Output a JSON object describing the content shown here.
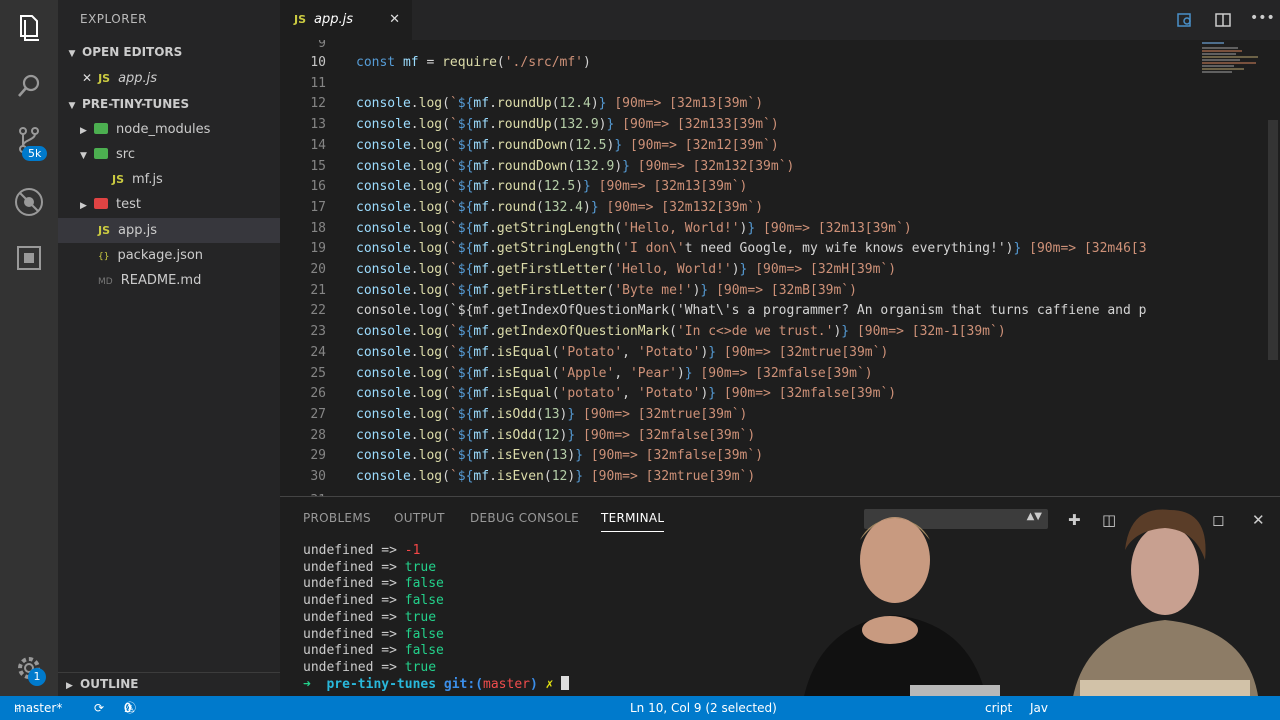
{
  "sidebar": {
    "title": "EXPLORER",
    "open_editors_label": "OPEN EDITORS",
    "open_editor_file": "app.js",
    "project_label": "PRE-TINY-TUNES",
    "tree": [
      {
        "label": "node_modules",
        "kind": "folder-green",
        "expanded": false
      },
      {
        "label": "src",
        "kind": "folder-green",
        "expanded": true
      },
      {
        "label": "mf.js",
        "kind": "js",
        "indent": 2
      },
      {
        "label": "test",
        "kind": "folder-red",
        "expanded": false
      },
      {
        "label": "app.js",
        "kind": "js",
        "selected": true
      },
      {
        "label": "package.json",
        "kind": "json"
      },
      {
        "label": "README.md",
        "kind": "md"
      }
    ],
    "outline_label": "OUTLINE"
  },
  "activity": {
    "scm_badge": "5k",
    "settings_badge": "1"
  },
  "editor": {
    "tab_label": "app.js",
    "tab_icon": "JS",
    "partial_top_line": "9",
    "partial_bottom_line": "31",
    "lines": [
      {
        "n": "10",
        "text": "const mf = require('./src/mf')"
      },
      {
        "n": "11",
        "text": ""
      },
      {
        "n": "12",
        "text": "console.log(`${mf.roundUp(12.4)} [90m=> [32m13[39m`)"
      },
      {
        "n": "13",
        "text": "console.log(`${mf.roundUp(132.9)} [90m=> [32m133[39m`)"
      },
      {
        "n": "14",
        "text": "console.log(`${mf.roundDown(12.5)} [90m=> [32m12[39m`)"
      },
      {
        "n": "15",
        "text": "console.log(`${mf.roundDown(132.9)} [90m=> [32m132[39m`)"
      },
      {
        "n": "16",
        "text": "console.log(`${mf.round(12.5)} [90m=> [32m13[39m`)"
      },
      {
        "n": "17",
        "text": "console.log(`${mf.round(132.4)} [90m=> [32m132[39m`)"
      },
      {
        "n": "18",
        "text": "console.log(`${mf.getStringLength('Hello, World!')} [90m=> [32m13[39m`)"
      },
      {
        "n": "19",
        "text": "console.log(`${mf.getStringLength('I don\\'t need Google, my wife knows everything!')} [90m=> [32m46[3"
      },
      {
        "n": "20",
        "text": "console.log(`${mf.getFirstLetter('Hello, World!')} [90m=> [32mH[39m`)"
      },
      {
        "n": "21",
        "text": "console.log(`${mf.getFirstLetter('Byte me!')} [90m=> [32mB[39m`)"
      },
      {
        "n": "22",
        "text": "console.log(`${mf.getIndexOfQuestionMark('What\\'s a programmer? An organism that turns caffiene and p"
      },
      {
        "n": "23",
        "text": "console.log(`${mf.getIndexOfQuestionMark('In c<>de we trust.')} [90m=> [32m-1[39m`)"
      },
      {
        "n": "24",
        "text": "console.log(`${mf.isEqual('Potato', 'Potato')} [90m=> [32mtrue[39m`)"
      },
      {
        "n": "25",
        "text": "console.log(`${mf.isEqual('Apple', 'Pear')} [90m=> [32mfalse[39m`)"
      },
      {
        "n": "26",
        "text": "console.log(`${mf.isEqual('potato', 'Potato')} [90m=> [32mfalse[39m`)"
      },
      {
        "n": "27",
        "text": "console.log(`${mf.isOdd(13)} [90m=> [32mtrue[39m`)"
      },
      {
        "n": "28",
        "text": "console.log(`${mf.isOdd(12)} [90m=> [32mfalse[39m`)"
      },
      {
        "n": "29",
        "text": "console.log(`${mf.isEven(13)} [90m=> [32mfalse[39m`)"
      },
      {
        "n": "30",
        "text": "console.log(`${mf.isEven(12)} [90m=> [32mtrue[39m`)"
      }
    ]
  },
  "panel": {
    "tabs": [
      "PROBLEMS",
      "OUTPUT",
      "DEBUG CONSOLE",
      "TERMINAL"
    ],
    "active_tab": "TERMINAL",
    "terminal_lines": [
      {
        "lhs": "undefined => ",
        "rhs": "-1",
        "color": "red"
      },
      {
        "lhs": "undefined => ",
        "rhs": "true",
        "color": "green"
      },
      {
        "lhs": "undefined => ",
        "rhs": "false",
        "color": "green"
      },
      {
        "lhs": "undefined => ",
        "rhs": "false",
        "color": "green"
      },
      {
        "lhs": "undefined => ",
        "rhs": "true",
        "color": "green"
      },
      {
        "lhs": "undefined => ",
        "rhs": "false",
        "color": "green"
      },
      {
        "lhs": "undefined => ",
        "rhs": "false",
        "color": "green"
      },
      {
        "lhs": "undefined => ",
        "rhs": "true",
        "color": "green"
      }
    ],
    "prompt": {
      "arrow": "➜",
      "dir": "pre-tiny-tunes",
      "git": "git:(",
      "branch": "master",
      "git_close": ")",
      "dirty": "✗"
    }
  },
  "statusbar": {
    "branch": "master*",
    "errors": "0",
    "warnings": "0",
    "cursor": "Ln 10, Col 9 (2 selected)",
    "lang_partial": "cript",
    "lang_partial2": "Jav"
  }
}
